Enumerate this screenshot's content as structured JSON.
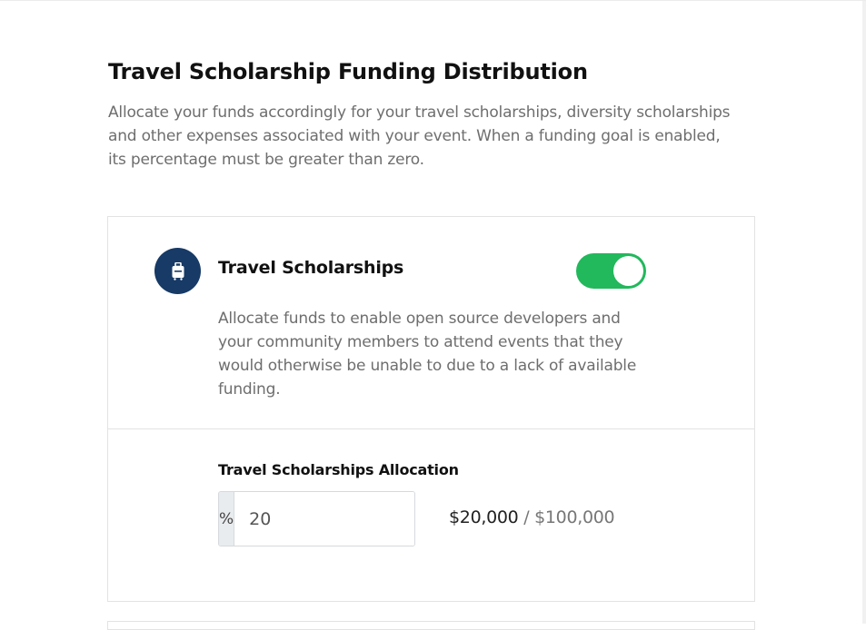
{
  "page": {
    "title": "Travel Scholarship Funding Distribution",
    "description": "Allocate your funds accordingly for your travel scholarships, diversity scholarships and other expenses associated with your event. When a funding goal is enabled, its percentage must be greater than zero."
  },
  "travel_card": {
    "icon": "luggage-icon",
    "title": "Travel Scholarships",
    "enabled": true,
    "description": "Allocate funds to enable open source developers and your community members to attend events that they would otherwise be unable to due to a lack of available funding.",
    "allocation": {
      "label": "Travel Scholarships Allocation",
      "prefix": "%",
      "value": "20",
      "allocated_amount": "$20,000",
      "separator": " / ",
      "total_amount": "$100,000"
    }
  },
  "colors": {
    "accent_green": "#22b85c",
    "badge_navy": "#173a66"
  }
}
